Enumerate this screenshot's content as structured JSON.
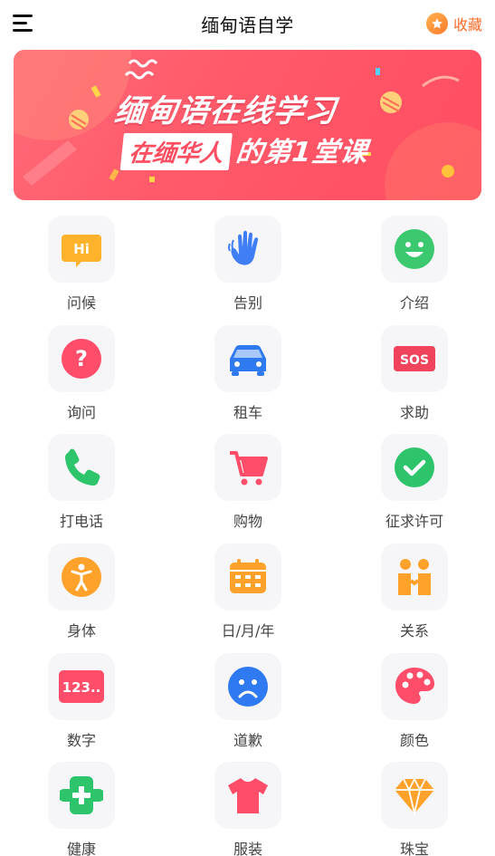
{
  "header": {
    "title": "缅甸语自学",
    "favorite_label": "收藏"
  },
  "banner": {
    "line1": "缅甸语在线学习",
    "line2_boxed": "在缅华人",
    "line2_rest": "的第1堂课"
  },
  "categories": [
    {
      "label": "问候",
      "icon": "hi-bubble-icon",
      "color": "#ffb22c"
    },
    {
      "label": "告别",
      "icon": "waving-hand-icon",
      "color": "#3f7ef5"
    },
    {
      "label": "介绍",
      "icon": "smiley-icon",
      "color": "#3cc86e"
    },
    {
      "label": "询问",
      "icon": "question-icon",
      "color": "#ff4d6a"
    },
    {
      "label": "租车",
      "icon": "car-icon",
      "color": "#2f7af0"
    },
    {
      "label": "求助",
      "icon": "sos-icon",
      "color": "#f0445c"
    },
    {
      "label": "打电话",
      "icon": "phone-icon",
      "color": "#2ec46c"
    },
    {
      "label": "购物",
      "icon": "shopping-cart-icon",
      "color": "#ff4d6a"
    },
    {
      "label": "征求许可",
      "icon": "checkmark-icon",
      "color": "#2ec46c"
    },
    {
      "label": "身体",
      "icon": "person-icon",
      "color": "#ffa22c"
    },
    {
      "label": "日/月/年",
      "icon": "calendar-icon",
      "color": "#ffa22c"
    },
    {
      "label": "关系",
      "icon": "handshake-icon",
      "color": "#ffa22c"
    },
    {
      "label": "数字",
      "icon": "numbers-icon",
      "color": "#ff4d6a"
    },
    {
      "label": "道歉",
      "icon": "sad-face-icon",
      "color": "#2f7af0"
    },
    {
      "label": "颜色",
      "icon": "palette-icon",
      "color": "#ff4d6a"
    },
    {
      "label": "健康",
      "icon": "health-cross-icon",
      "color": "#2ec46c"
    },
    {
      "label": "服装",
      "icon": "tshirt-icon",
      "color": "#ff4d6a"
    },
    {
      "label": "珠宝",
      "icon": "diamond-icon",
      "color": "#ffa22c"
    }
  ],
  "icon_texts": {
    "hi": "Hi",
    "sos": "SOS",
    "numbers": "123.."
  }
}
